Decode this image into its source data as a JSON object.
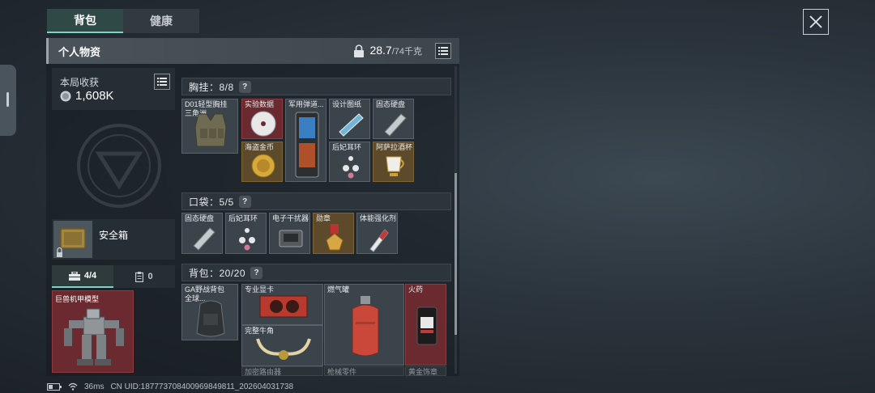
{
  "tabs": {
    "backpack": "背包",
    "health": "健康"
  },
  "panel": {
    "title": "个人物资",
    "weight_current": "28.7",
    "weight_max": "/74千克"
  },
  "haul": {
    "label": "本局收获",
    "value": "1,608K"
  },
  "safe_box": {
    "label": "安全箱"
  },
  "slot_tabs": {
    "a": "4/4",
    "b": "0"
  },
  "mech_item": {
    "name": "巨兽机甲模型"
  },
  "sections": {
    "chest": {
      "title": "胸挂：8/8"
    },
    "pocket": {
      "title": "口袋：5/5"
    },
    "backpack": {
      "title": "背包：20/20"
    }
  },
  "chest_items": [
    {
      "name": "D01轻型胸挂",
      "subname": "三角洲"
    },
    {
      "name": "实验数据"
    },
    {
      "name": "军用弹道..."
    },
    {
      "name": "设计图纸"
    },
    {
      "name": "固态硬盘"
    },
    {
      "name": "海盗金币"
    },
    {
      "name": "后妃耳环"
    },
    {
      "name": "阿萨拉酒杯"
    }
  ],
  "pocket_items": [
    {
      "name": "固态硬盘"
    },
    {
      "name": "后妃耳环"
    },
    {
      "name": "电子干扰器"
    },
    {
      "name": "勋章"
    },
    {
      "name": "体能强化剂"
    }
  ],
  "backpack_items": [
    {
      "name": "GA野战背包",
      "subname": "全球..."
    },
    {
      "name": "专业显卡"
    },
    {
      "name": "燃气罐"
    },
    {
      "name": "火药"
    },
    {
      "name": "完整牛角"
    },
    {
      "name": "加密路由器"
    },
    {
      "name": "枪械零件"
    },
    {
      "name": "黄金饰章"
    }
  ],
  "status_bar": {
    "ping": "36ms",
    "uid": "CN UID:187773708400969849811_202604031738"
  },
  "colors": {
    "accent": "#7fd3c4",
    "gold_item": "#5c4a2a",
    "red_item": "#6b2a2f",
    "gray_item": "#3b444b"
  },
  "icons": [
    "close-icon",
    "list-icon",
    "lock-icon",
    "coin-icon",
    "help-icon",
    "battery-icon",
    "wifi-icon",
    "toolbox-icon",
    "clipboard-icon"
  ]
}
